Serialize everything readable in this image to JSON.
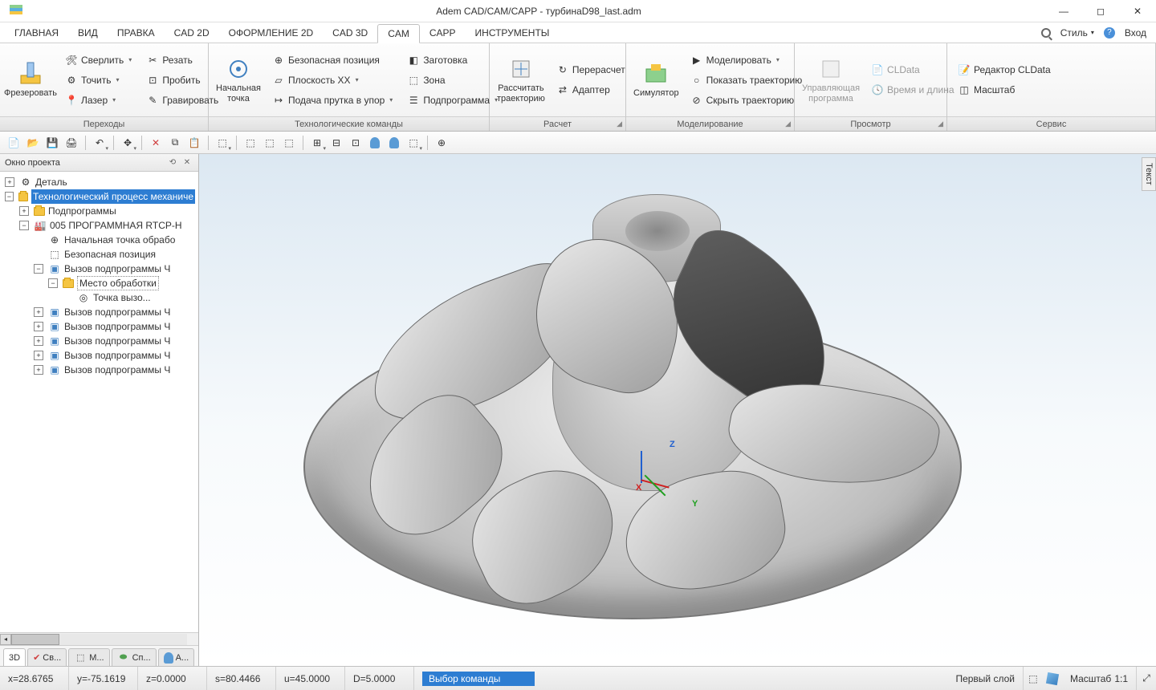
{
  "title": "Adem CAD/CAM/CAPP - турбинаD98_last.adm",
  "menu": {
    "tabs": [
      "ГЛАВНАЯ",
      "ВИД",
      "ПРАВКА",
      "CAD 2D",
      "ОФОРМЛЕНИЕ 2D",
      "CAD 3D",
      "CAM",
      "CAPP",
      "ИНСТРУМЕНТЫ"
    ],
    "active": "CAM",
    "style_label": "Стиль",
    "login": "Вход"
  },
  "ribbon": {
    "g1": {
      "label": "Переходы",
      "mill": "Фрезеровать",
      "items": [
        "Сверлить",
        "Резать",
        "Точить",
        "Пробить",
        "Лазер",
        "Гравировать"
      ]
    },
    "g2": {
      "label": "Технологические команды",
      "start": "Начальная\nточка",
      "rows": [
        [
          "Безопасная позиция",
          "Заготовка"
        ],
        [
          "Плоскость XX",
          "Зона"
        ],
        [
          "Подача прутка в упор",
          "Подпрограмма"
        ]
      ]
    },
    "g3": {
      "label": "Расчет",
      "calc": "Рассчитать\nтраекторию",
      "recalc": "Перерасчет",
      "adapter": "Адаптер"
    },
    "g4": {
      "label": "Моделирование",
      "sim": "Симулятор",
      "model": "Моделировать",
      "show": "Показать траекторию",
      "hide": "Скрыть траекторию"
    },
    "g5": {
      "label": "Просмотр",
      "prog": "Управляющая\nпрограмма",
      "cldata": "CLData",
      "time": "Время и длина"
    },
    "g6": {
      "label": "Сервис",
      "editor": "Редактор CLData",
      "scale": "Масштаб"
    }
  },
  "project": {
    "title": "Окно проекта",
    "detail": "Деталь",
    "tech": "Технологический процесс механиче",
    "subprog": "Подпрограммы",
    "prog005": "005  ПРОГРАММНАЯ RTCP-Н",
    "startpt": "Начальная точка обрабо",
    "safepos": "Безопасная позиция",
    "call": "Вызов подпрограммы Ч",
    "place": "Место обработки",
    "callpt": "Точка вызо...",
    "tabs": {
      "t1": "3D",
      "t2": "Св...",
      "t3": "М...",
      "t4": "Сп...",
      "t5": "А..."
    }
  },
  "viewport": {
    "text_tab": "Текст"
  },
  "axes": {
    "x": "X",
    "y": "Y",
    "z": "Z"
  },
  "status": {
    "x": "x=28.6765",
    "y": "y=-75.1619",
    "z": "z=0.0000",
    "s": "s=80.4466",
    "u": "u=45.0000",
    "d": "D=5.0000",
    "cmd": "Выбор команды",
    "layer": "Первый слой",
    "scale_label": "Масштаб",
    "scale_value": "1:1"
  }
}
